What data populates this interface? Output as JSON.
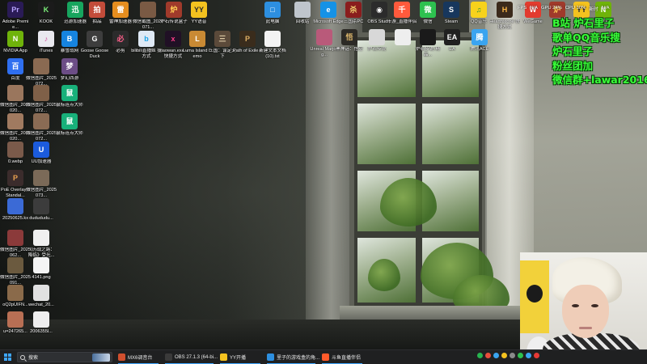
{
  "desktop": {
    "icons": [
      {
        "id": "adobe",
        "label": "Adobe Premie...",
        "color": "#2a1b56",
        "glyph": "Pr",
        "fg": "#b7a3ff"
      },
      {
        "id": "kook",
        "label": "KOOK",
        "color": "#1b1b1b",
        "glyph": "K",
        "fg": "#7cf07a"
      },
      {
        "id": "xunyou",
        "label": "迅游加速器",
        "color": "#17a55e",
        "glyph": "迅",
        "fg": "#fff"
      },
      {
        "id": "zhuanpin",
        "label": "拍品",
        "color": "#c34c3a",
        "glyph": "拍",
        "fg": "#fff"
      },
      {
        "id": "leishen",
        "label": "雷神加速器",
        "color": "#e58d1e",
        "glyph": "雷",
        "fg": "#fff"
      },
      {
        "id": "weixin-shot",
        "label": "微信截图_2024071...",
        "color": "#7a5a44",
        "glyph": "",
        "fg": "#fff"
      },
      {
        "id": "lushi-gongshe",
        "label": "炉石传说盒子",
        "color": "#a03a2b",
        "glyph": "炉",
        "fg": "#ffcc55"
      },
      {
        "id": "yy-voice",
        "label": "YY语音",
        "color": "#f4c21f",
        "glyph": "YY",
        "fg": "#2a2a2a"
      },
      {
        "id": "nvidia",
        "label": "NVIDIA App",
        "color": "#6fb30a",
        "glyph": "N",
        "fg": "#fff"
      },
      {
        "id": "itunes",
        "label": "iTunes",
        "color": "#e9e9ef",
        "glyph": "♪",
        "fg": "#d24b9b"
      },
      {
        "id": "baidu-pan",
        "label": "暴雪战网",
        "color": "#1684e0",
        "glyph": "B",
        "fg": "#fff"
      },
      {
        "id": "goose",
        "label": "Goose Goose Duck",
        "color": "#3d3d3d",
        "glyph": "G",
        "fg": "#fff"
      },
      {
        "id": "biying",
        "label": "必剪",
        "color": "#2b2b2b",
        "glyph": "必",
        "fg": "#ff5f8a"
      },
      {
        "id": "bilibili-live",
        "label": "bilibili直播姬 捷方式",
        "color": "#dfe9f5",
        "glyph": "b",
        "fg": "#1aa3e8"
      },
      {
        "id": "xiaowan",
        "label": "xiaowan.exe - 快捷方式",
        "color": "#201025",
        "glyph": "x",
        "fg": "#ff3e8b"
      },
      {
        "id": "luma",
        "label": "Luma Island Demo",
        "color": "#c98a34",
        "glyph": "L",
        "fg": "#fff"
      },
      {
        "id": "sanguo",
        "label": "三国：谋定天下",
        "color": "#5b4a3a",
        "glyph": "三",
        "fg": "#e9d7b0"
      },
      {
        "id": "path-of-exile",
        "label": "Path of Exile 2",
        "color": "#3a2c1c",
        "glyph": "P",
        "fg": "#e0b064"
      },
      {
        "id": "new-txt",
        "label": "新建文本文档 (10).txt",
        "color": "#f3f3f3",
        "glyph": "",
        "fg": "#555"
      },
      {
        "id": "baidu",
        "label": "百度",
        "color": "#2f6ff0",
        "glyph": "百",
        "fg": "#fff"
      },
      {
        "id": "weixin-img1",
        "label": "微信图片_2025072...",
        "color": "#8a6a52",
        "glyph": "",
        "fg": "#fff"
      },
      {
        "id": "mengji",
        "label": "梦幻西游",
        "color": "#6c4d86",
        "glyph": "梦",
        "fg": "#fff"
      },
      {
        "id": "weixin-img2",
        "label": "微信图片_2025020...",
        "color": "#9a765d",
        "glyph": "",
        "fg": "#fff"
      },
      {
        "id": "weixin-img3",
        "label": "微信图片_2025072...",
        "color": "#7f6048",
        "glyph": "",
        "fg": "#fff"
      },
      {
        "id": "shubiao1",
        "label": "鼠标连点大师",
        "color": "#18b07a",
        "glyph": "鼠",
        "fg": "#fff"
      },
      {
        "id": "weixin-img4",
        "label": "微信图片_2025020...",
        "color": "#a07a60",
        "glyph": "",
        "fg": "#fff"
      },
      {
        "id": "weixin-img5",
        "label": "微信图片_2025072...",
        "color": "#8a6b54",
        "glyph": "",
        "fg": "#fff"
      },
      {
        "id": "shubiao2",
        "label": "鼠标连点大师",
        "color": "#18b07a",
        "glyph": "鼠",
        "fg": "#fff"
      },
      {
        "id": "webp0",
        "label": "0.webp",
        "color": "#7a5a4a",
        "glyph": "",
        "fg": "#fff"
      },
      {
        "id": "uu",
        "label": "UU加速器",
        "color": "#1b5bdc",
        "glyph": "U",
        "fg": "#fff"
      },
      {
        "id": "poe-overlay",
        "label": "PoE Overlay II Standal...",
        "color": "#3b2c2c",
        "glyph": "P",
        "fg": "#e8a050"
      },
      {
        "id": "weixin-img6",
        "label": "微信图片_2025073...",
        "color": "#7b6a58",
        "glyph": "",
        "fg": "#fff"
      },
      {
        "id": "kx-file",
        "label": "20250625.kx",
        "color": "#3b6ad6",
        "glyph": "",
        "fg": "#fff"
      },
      {
        "id": "dudu",
        "label": "dudududu...",
        "color": "#3c3c3c",
        "glyph": "",
        "fg": "#fff"
      },
      {
        "id": "weixin-img7",
        "label": "微信图片_2025062...",
        "color": "#8b3a3a",
        "glyph": "",
        "fg": "#fff"
      },
      {
        "id": "yuanqi",
        "label": "《历战之路：降临》受光...",
        "color": "#f0f0f0",
        "glyph": "",
        "fg": "#555"
      },
      {
        "id": "weixin-img8",
        "label": "微信图片_2025091...",
        "color": "#6b5a3f",
        "glyph": "",
        "fg": "#fff"
      },
      {
        "id": "png4141",
        "label": "4141.png",
        "color": "#f4f4f4",
        "glyph": "",
        "fg": "#666"
      },
      {
        "id": "oq2p",
        "label": "oQ2pUIFN...",
        "color": "#8a6a4a",
        "glyph": "",
        "fg": "#fff"
      },
      {
        "id": "wechat-img",
        "label": "wechat_20...",
        "color": "#e1e1e1",
        "glyph": "",
        "fg": "#666"
      },
      {
        "id": "u-file",
        "label": "u=247265...",
        "color": "#b86f54",
        "glyph": "",
        "fg": "#fff"
      },
      {
        "id": "file2006",
        "label": "2006355l...",
        "color": "#eeeeee",
        "glyph": "",
        "fg": "#666"
      },
      {
        "id": "cc-pc",
        "label": "此电脑",
        "color": "#2d8fe0",
        "glyph": "□",
        "fg": "#fff"
      },
      {
        "id": "huishou",
        "label": "回收站",
        "color": "#bfc5cc",
        "glyph": "",
        "fg": "#fff"
      },
      {
        "id": "edge",
        "label": "Microsoft Edge",
        "color": "#1592e6",
        "glyph": "e",
        "fg": "#fff"
      },
      {
        "id": "sanguo-pc",
        "label": "三国杀PC",
        "color": "#8a1d1d",
        "glyph": "杀",
        "fg": "#f0d070"
      },
      {
        "id": "obs",
        "label": "OBS Studio",
        "color": "#2b2b2b",
        "glyph": "◉",
        "fg": "#fff"
      },
      {
        "id": "qianyou",
        "label": "千游_直播伴侣",
        "color": "#ff5a3c",
        "glyph": "千",
        "fg": "#fff"
      },
      {
        "id": "weixin",
        "label": "微信",
        "color": "#2dc14f",
        "glyph": "微",
        "fg": "#fff"
      },
      {
        "id": "steam",
        "label": "Steam",
        "color": "#17375d",
        "glyph": "S",
        "fg": "#fff"
      },
      {
        "id": "qq-music",
        "label": "QQ音乐",
        "color": "#f7d21c",
        "glyph": "♫",
        "fg": "#2a8f3c"
      },
      {
        "id": "hearthstone",
        "label": "Hearthstone 快捷方式",
        "color": "#3b2a1b",
        "glyph": "H",
        "fg": "#ffb846"
      },
      {
        "id": "wegame",
        "label": "WeGame",
        "color": "#e33b2e",
        "glyph": "W",
        "fg": "#fff"
      },
      {
        "id": "lushi-box2",
        "label": "炉石",
        "color": "#a03a2b",
        "glyph": "炉",
        "fg": "#ffcc55"
      },
      {
        "id": "yy-voice2",
        "label": "YY语音",
        "color": "#f4c21f",
        "glyph": "YY",
        "fg": "#2a2a2a"
      },
      {
        "id": "nvidia-app2",
        "label": "NVIDIA",
        "color": "#6fb30a",
        "glyph": "N",
        "fg": "#fff"
      },
      {
        "id": "makeup",
        "label": "Unreal Marjong...",
        "color": "#b95a7a",
        "glyph": "",
        "fg": "#fff"
      },
      {
        "id": "heishenhua",
        "label": "黑神话：悟空",
        "color": "#2c2a26",
        "glyph": "悟",
        "fg": "#d9b36a"
      },
      {
        "id": "lushi-chuanshuo",
        "label": "炉石传说",
        "color": "#d8d8d8",
        "glyph": "",
        "fg": "#555"
      },
      {
        "id": "blank-file",
        "label": "",
        "color": "#eeeeee",
        "glyph": "",
        "fg": "#666"
      },
      {
        "id": "lushi-box3",
        "label": "炉石传说-精品...",
        "color": "#1a1a1a",
        "glyph": "",
        "fg": "#fff"
      },
      {
        "id": "ea-app",
        "label": "EA",
        "color": "#202020",
        "glyph": "EA",
        "fg": "#fff"
      },
      {
        "id": "tengxun-app",
        "label": "腾讯ACE",
        "color": "#3aa4f0",
        "glyph": "腾",
        "fg": "#fff"
      }
    ]
  },
  "overlay": {
    "lines": [
      "B站 炉石里子",
      "歌单QQ音乐搜",
      "炉石里子",
      "粉丝团加",
      "微信群+lawar2016"
    ],
    "color": "#39ff39"
  },
  "status_strip": {
    "items": [
      "FPS",
      "N/A",
      "GPU 24%",
      "CPU 10%",
      "新时",
      "N/A"
    ]
  },
  "taskbar": {
    "search_placeholder": "搜索",
    "apps": [
      {
        "label": "MX6调音台",
        "color": "#d04f2e",
        "active": true
      },
      {
        "label": "OBS 27.1.3 (64-bi...",
        "color": "#3a3a3a",
        "active": true
      },
      {
        "label": "YY开播",
        "color": "#f4c21f",
        "active": true
      },
      {
        "label": "里子的游戏盒的角...",
        "color": "#2d8fe0",
        "active": true
      },
      {
        "label": "斗鱼直播伴侣",
        "color": "#ff5a2a",
        "active": true
      }
    ],
    "tray_colors": [
      "#27b34f",
      "#e84d3c",
      "#3aa4f0",
      "#f4c21f",
      "#8a8a8a",
      "#2dc14f",
      "#3aa4f0",
      "#e53935"
    ]
  }
}
